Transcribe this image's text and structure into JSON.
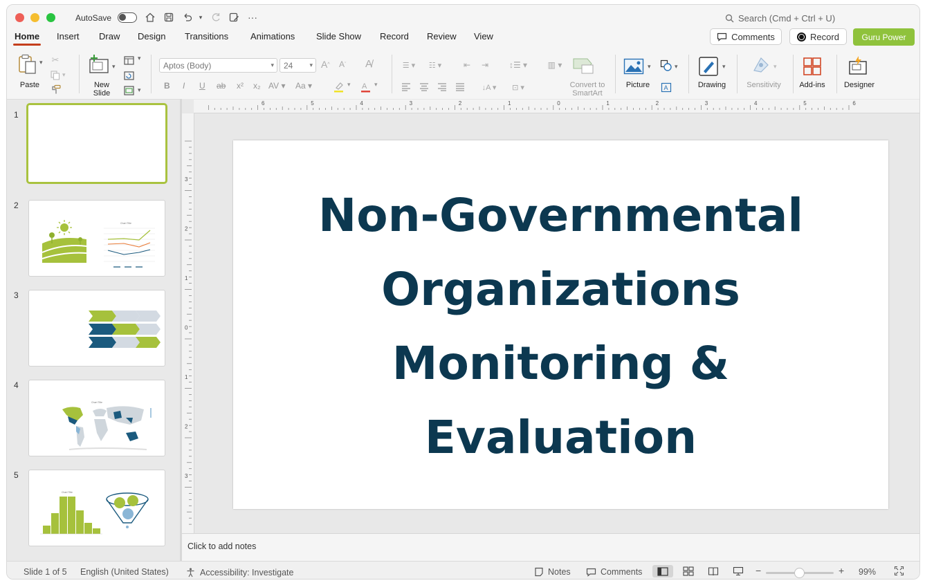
{
  "titlebar": {
    "autosave_label": "AutoSave",
    "search_placeholder": "Search (Cmd + Ctrl + U)"
  },
  "tabs": [
    "Home",
    "Insert",
    "Draw",
    "Design",
    "Transitions",
    "Animations",
    "Slide Show",
    "Record",
    "Review",
    "View"
  ],
  "actions": {
    "comments": "Comments",
    "record": "Record",
    "guru": "Guru Power"
  },
  "ribbon": {
    "paste": "Paste",
    "new_slide_1": "New",
    "new_slide_2": "Slide",
    "font_name": "Aptos (Body)",
    "font_size": "24",
    "convert_1": "Convert to",
    "convert_2": "SmartArt",
    "picture": "Picture",
    "drawing": "Drawing",
    "sensitivity": "Sensitivity",
    "addins": "Add-ins",
    "designer": "Designer"
  },
  "thumbnails": {
    "numbers": [
      "1",
      "2",
      "3",
      "4",
      "5"
    ],
    "chart_title_small": "Chart Title"
  },
  "slide": {
    "title_lines": [
      "Non-Governmental",
      "Organizations",
      "Monitoring &",
      "Evaluation"
    ]
  },
  "notes": {
    "placeholder": "Click to add notes"
  },
  "status": {
    "slide_info": "Slide 1 of 5",
    "language": "English (United States)",
    "accessibility": "Accessibility: Investigate",
    "notes": "Notes",
    "comments": "Comments",
    "zoom": "99%"
  },
  "ruler": {
    "h_labels": [
      "6",
      "5",
      "4",
      "3",
      "2",
      "1",
      "0",
      "1",
      "2",
      "3",
      "4",
      "5",
      "6"
    ],
    "v_labels": [
      "3",
      "2",
      "1",
      "0",
      "1",
      "2",
      "3"
    ]
  },
  "colors": {
    "title": "#0c3850",
    "accent_green": "#8fc23c",
    "tab_underline": "#c43e1c",
    "navy": "#1b5a7e",
    "grey_chevron": "#d3dae2"
  }
}
